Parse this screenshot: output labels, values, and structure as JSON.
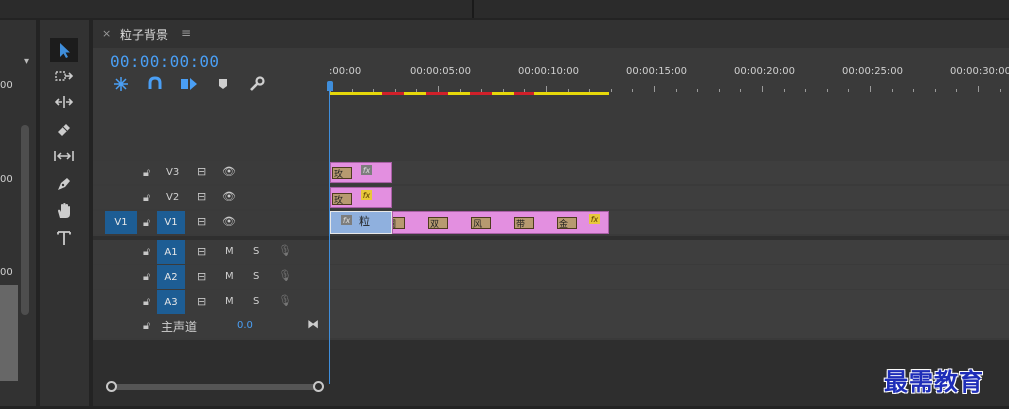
{
  "sequence": {
    "tab_close": "×",
    "title": "粒子背景",
    "menu": "≡",
    "timecode": "00:00:00:00"
  },
  "left_panel": {
    "numbers": [
      "00",
      "00",
      "00",
      "00"
    ]
  },
  "ruler": {
    "labels": [
      ":00:00",
      "00:00:05:00",
      "00:00:10:00",
      "00:00:15:00",
      "00:00:20:00",
      "00:00:25:00",
      "00:00:30:00"
    ]
  },
  "tracks": {
    "video": [
      {
        "name": "V3",
        "source": ""
      },
      {
        "name": "V2",
        "source": ""
      },
      {
        "name": "V1",
        "source": "V1"
      }
    ],
    "audio": [
      {
        "name": "A1",
        "m": "M",
        "s": "S"
      },
      {
        "name": "A2",
        "m": "M",
        "s": "S"
      },
      {
        "name": "A3",
        "m": "M",
        "s": "S"
      }
    ],
    "master": {
      "label": "主声道",
      "value": "0.0"
    }
  },
  "clips": {
    "v3_label": "玫",
    "v2_label": "玫",
    "v1_first_label": "粒",
    "v1_segments": [
      "圆",
      "双",
      "风",
      "带",
      "金"
    ],
    "fx": "fx"
  },
  "watermark": "最需教育",
  "colors": {
    "accent": "#4a9ff5",
    "clip": "#e38fe0",
    "track_target": "#1d5d94",
    "work_area_yellow": "#e6d80a",
    "render_red": "#d0202a"
  }
}
